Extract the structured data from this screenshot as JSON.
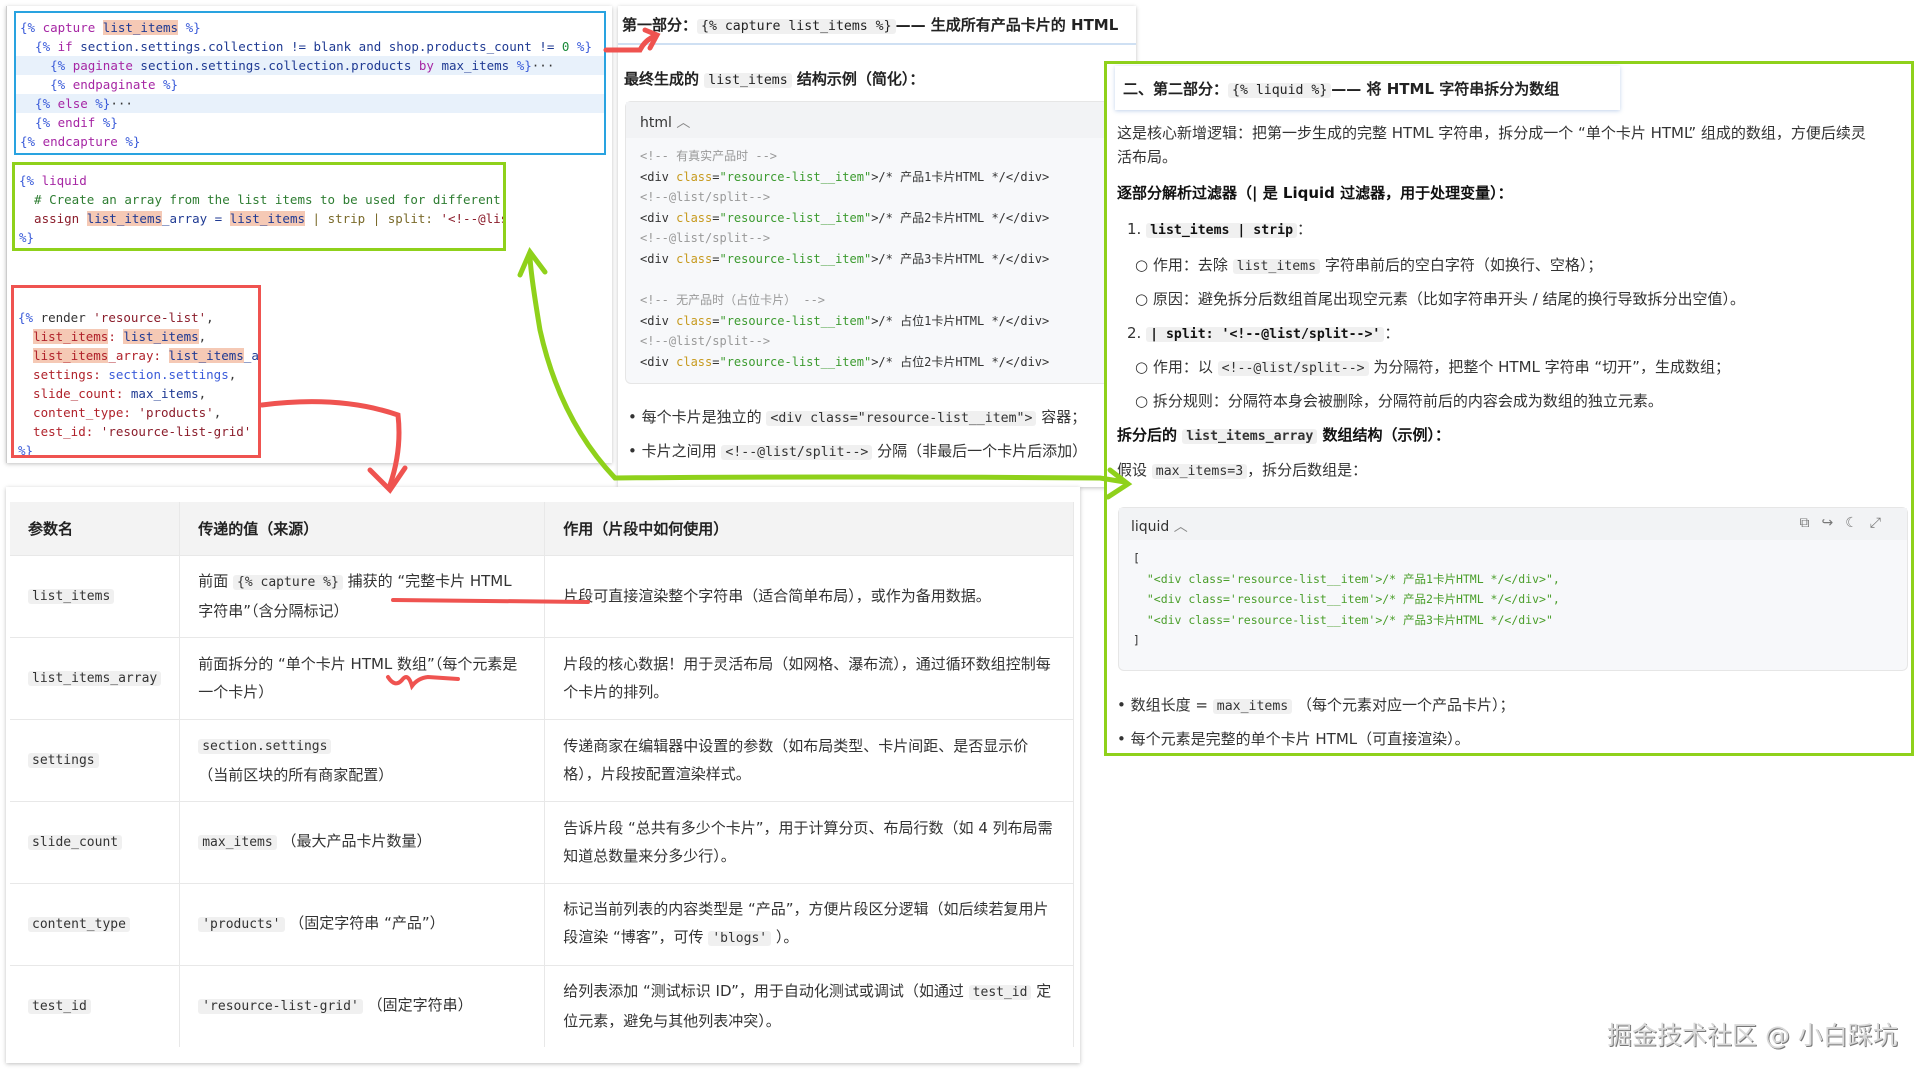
{
  "capture_block": [
    [
      [
        "{% ",
        "delim"
      ],
      [
        "capture ",
        "kw"
      ],
      [
        "list_items",
        "hl"
      ],
      [
        " %}",
        "delim"
      ]
    ],
    [
      [
        "  {% ",
        "delim"
      ],
      [
        "if ",
        "kw"
      ],
      [
        "section.settings.collection ",
        "var"
      ],
      [
        "!= ",
        "var"
      ],
      [
        "blank ",
        "var"
      ],
      [
        "and ",
        "var"
      ],
      [
        "shop.products_count ",
        "var"
      ],
      [
        "!= ",
        "var"
      ],
      [
        "0",
        "num"
      ],
      [
        " %}",
        "delim"
      ]
    ],
    [
      [
        "    {% ",
        "delim"
      ],
      [
        "paginate ",
        "kw"
      ],
      [
        "section.settings.collection.products ",
        "var"
      ],
      [
        "by ",
        "kw"
      ],
      [
        "max_items ",
        "var"
      ],
      [
        "%}",
        "delim"
      ],
      [
        "···",
        "plain"
      ]
    ],
    [
      [
        "    {% ",
        "delim"
      ],
      [
        "endpaginate ",
        "kw"
      ],
      [
        "%}",
        "delim"
      ]
    ],
    [
      [
        "  {% ",
        "delim"
      ],
      [
        "else ",
        "kw"
      ],
      [
        "%}",
        "delim"
      ],
      [
        "···",
        "plain"
      ]
    ],
    [
      [
        "  {% ",
        "delim"
      ],
      [
        "endif ",
        "kw"
      ],
      [
        "%}",
        "delim"
      ]
    ],
    [
      [
        "{% ",
        "delim"
      ],
      [
        "endcapture ",
        "kw"
      ],
      [
        "%}",
        "delim"
      ]
    ]
  ],
  "liquid_block": [
    [
      [
        "{% ",
        "delim"
      ],
      [
        "liquid",
        "kw"
      ]
    ],
    [
      [
        "  # Create an array from the list items to be used for different layout types",
        "comment"
      ]
    ],
    [
      [
        "  assign ",
        "assign"
      ],
      [
        "list_items",
        "hl"
      ],
      [
        "_array = ",
        "var"
      ],
      [
        "list_items",
        "hl"
      ],
      [
        " | strip | split: ",
        "filter"
      ],
      [
        "'<!--@list/split-->'",
        "str"
      ]
    ],
    [
      [
        "%}",
        "delim"
      ]
    ]
  ],
  "render_block": [
    [
      [
        "{% ",
        "delim"
      ],
      [
        "render ",
        "plain"
      ],
      [
        "'resource-list'",
        "str"
      ],
      [
        ",",
        "plain"
      ]
    ],
    [
      [
        "  ",
        "plain"
      ],
      [
        "list_items",
        "hlr"
      ],
      [
        ": ",
        "key"
      ],
      [
        "list_items",
        "hl"
      ],
      [
        ",",
        "plain"
      ]
    ],
    [
      [
        "  ",
        "plain"
      ],
      [
        "list_items",
        "hlr"
      ],
      [
        "_array: ",
        "key"
      ],
      [
        "list_items",
        "hl"
      ],
      [
        "_array,",
        "var"
      ]
    ],
    [
      [
        "  settings: ",
        "key"
      ],
      [
        "section.settings",
        "delim"
      ],
      [
        ",",
        "plain"
      ]
    ],
    [
      [
        "  slide_count: ",
        "key"
      ],
      [
        "max_items",
        "var"
      ],
      [
        ",",
        "plain"
      ]
    ],
    [
      [
        "  content_type: ",
        "key"
      ],
      [
        "'products'",
        "str"
      ],
      [
        ",",
        "plain"
      ]
    ],
    [
      [
        "  test_id: ",
        "key"
      ],
      [
        "'resource-list-grid'",
        "str"
      ]
    ],
    [
      [
        "%}",
        "delim"
      ]
    ]
  ],
  "part1": {
    "title_pre": "第一部分：",
    "title_code": "{% capture list_items %}",
    "title_post": "—— 生成所有产品卡片的 HTML",
    "subtitle_pre": "最终生成的",
    "subtitle_code": "list_items",
    "subtitle_post": "结构示例（简化）：",
    "code_lang": "html",
    "code_lines": [
      [
        [
          "<!-- 有真实产品时 -->",
          "hcomment"
        ]
      ],
      [
        [
          "<div ",
          "tag"
        ],
        [
          "class",
          "attr"
        ],
        [
          "=",
          "tag"
        ],
        [
          "\"resource-list__item\"",
          "val"
        ],
        [
          ">/* 产品1卡片HTML */</div>",
          "tag"
        ]
      ],
      [
        [
          "<!--@list/split-->",
          "hcomment"
        ]
      ],
      [
        [
          "<div ",
          "tag"
        ],
        [
          "class",
          "attr"
        ],
        [
          "=",
          "tag"
        ],
        [
          "\"resource-list__item\"",
          "val"
        ],
        [
          ">/* 产品2卡片HTML */</div>",
          "tag"
        ]
      ],
      [
        [
          "<!--@list/split-->",
          "hcomment"
        ]
      ],
      [
        [
          "<div ",
          "tag"
        ],
        [
          "class",
          "attr"
        ],
        [
          "=",
          "tag"
        ],
        [
          "\"resource-list__item\"",
          "val"
        ],
        [
          ">/* 产品3卡片HTML */</div>",
          "tag"
        ]
      ],
      [
        [
          "",
          "plain"
        ]
      ],
      [
        [
          "<!-- 无产品时（占位卡片） -->",
          "hcomment"
        ]
      ],
      [
        [
          "<div ",
          "tag"
        ],
        [
          "class",
          "attr"
        ],
        [
          "=",
          "tag"
        ],
        [
          "\"resource-list__item\"",
          "val"
        ],
        [
          ">/* 占位1卡片HTML */</div>",
          "tag"
        ]
      ],
      [
        [
          "<!--@list/split-->",
          "hcomment"
        ]
      ],
      [
        [
          "<div ",
          "tag"
        ],
        [
          "class",
          "attr"
        ],
        [
          "=",
          "tag"
        ],
        [
          "\"resource-list__item\"",
          "val"
        ],
        [
          ">/* 占位2卡片HTML */</div>",
          "tag"
        ]
      ]
    ],
    "bullet1_pre": "每个卡片是独立的",
    "bullet1_code": "<div class=\"resource-list__item\">",
    "bullet1_post": "容器；",
    "bullet2_pre": "卡片之间用",
    "bullet2_code": "<!--@list/split-->",
    "bullet2_post": "分隔（非最后一个卡片后添加）"
  },
  "part2": {
    "title_pre": "二、第二部分：",
    "title_code": "{% liquid %}",
    "title_post": "—— 将 HTML 字符串拆分为数组",
    "intro_line1": "这是核心新增逻辑：把第一步生成的完整 HTML 字符串，拆分成一个 “单个卡片 HTML” 组成的数组，方便后续灵",
    "intro_line2": "活布局。",
    "filter_heading": "逐部分解析过滤器（| 是 Liquid 过滤器，用于处理变量）：",
    "step1_num": "1.",
    "step1_code": "list_items | strip",
    "step1_colon": "：",
    "step1_a_pre": "作用：去除",
    "step1_a_code": "list_items",
    "step1_a_post": "字符串前后的空白字符（如换行、空格）；",
    "step1_b": "原因：避免拆分后数组首尾出现空元素（比如字符串开头 / 结尾的换行导致拆分出空值）。",
    "step2_num": "2.",
    "step2_code": "| split: '<!--@list/split-->'",
    "step2_colon": "：",
    "step2_a_pre": "作用：以",
    "step2_a_code": "<!--@list/split-->",
    "step2_a_post": "为分隔符，把整个 HTML 字符串 “切开”，生成数组；",
    "step2_b": "拆分规则：分隔符本身会被删除，分隔符前后的内容会成为数组的独立元素。",
    "array_heading_pre": "拆分后的",
    "array_heading_code": "list_items_array",
    "array_heading_post": "数组结构（示例）：",
    "assume_pre": "假设",
    "assume_code": "max_items=3",
    "assume_post": "，拆分后数组是：",
    "code_lang": "liquid",
    "code_lines": [
      [
        [
          "[",
          "plain"
        ]
      ],
      [
        [
          "  \"<div class='resource-list__item'>/* 产品1卡片HTML */</div>\",",
          "green"
        ]
      ],
      [
        [
          "  \"<div class='resource-list__item'>/* 产品2卡片HTML */</div>\",",
          "green"
        ]
      ],
      [
        [
          "  \"<div class='resource-list__item'>/* 产品3卡片HTML */</div>\"",
          "green"
        ]
      ],
      [
        [
          "]",
          "plain"
        ]
      ]
    ],
    "bullet1_pre": "数组长度 =",
    "bullet1_code": "max_items",
    "bullet1_post": "（每个元素对应一个产品卡片）；",
    "bullet2": "每个元素是完整的单个卡片 HTML（可直接渲染）。"
  },
  "table": {
    "headers": [
      "参数名",
      "传递的值（来源）",
      "作用（片段中如何使用）"
    ],
    "rows": [
      {
        "name": "list_items",
        "value_pre": "前面",
        "value_code": "{% capture %}",
        "value_post": "捕获的 “完整卡片 HTML 字符串”（含分隔标记）",
        "use_pre": "片段可直接渲染整个字符串（适合简单布局），或作为备用数据。",
        "use_code": "",
        "use_post": ""
      },
      {
        "name": "list_items_array",
        "value_pre": "",
        "value_code": "",
        "value_post": "前面拆分的 “单个卡片 HTML 数组”（每个元素是一个卡片）",
        "use_pre": "片段的核心数据！用于灵活布局（如网格、瀑布流），通过循环数组控制每个卡片的排列。",
        "use_code": "",
        "use_post": ""
      },
      {
        "name": "settings",
        "value_pre": "",
        "value_code": "section.settings",
        "value_post": "（当前区块的所有商家配置）",
        "use_pre": "传递商家在编辑器中设置的参数（如布局类型、卡片间距、是否显示价格），片段按配置渲染样式。",
        "use_code": "",
        "use_post": ""
      },
      {
        "name": "slide_count",
        "value_pre": "",
        "value_code": "max_items",
        "value_post": "（最大产品卡片数量）",
        "use_pre": "告诉片段 “总共有多少个卡片”，用于计算分页、布局行数（如 4 列布局需知道总数量来分多少行）。",
        "use_code": "",
        "use_post": ""
      },
      {
        "name": "content_type",
        "value_pre": "",
        "value_code": "'products'",
        "value_post": "（固定字符串 “产品”）",
        "use_pre": "标记当前列表的内容类型是 “产品”，方便片段区分逻辑（如后续若复用片段渲染 “博客”，可传",
        "use_code": "'blogs'",
        "use_post": "）。"
      },
      {
        "name": "test_id",
        "value_pre": "",
        "value_code": "'resource-list-grid'",
        "value_post": "（固定字符串）",
        "use_pre": "给列表添加 “测试标识 ID”，用于自动化测试或调试（如通过",
        "use_code": "test_id",
        "use_post": "定位元素，避免与其他列表冲突）。"
      }
    ]
  },
  "code_toolbar_icons": [
    "copy-icon",
    "wrap-icon",
    "theme-icon",
    "expand-icon"
  ],
  "watermark": "掘金技术社区 @ 小白踩坑",
  "colors": {
    "blue_box": "#29a3e0",
    "green_box": "#8fd11b",
    "red_box": "#ef5350",
    "arrow_green": "#8fd11b",
    "arrow_red": "#ef5350"
  }
}
